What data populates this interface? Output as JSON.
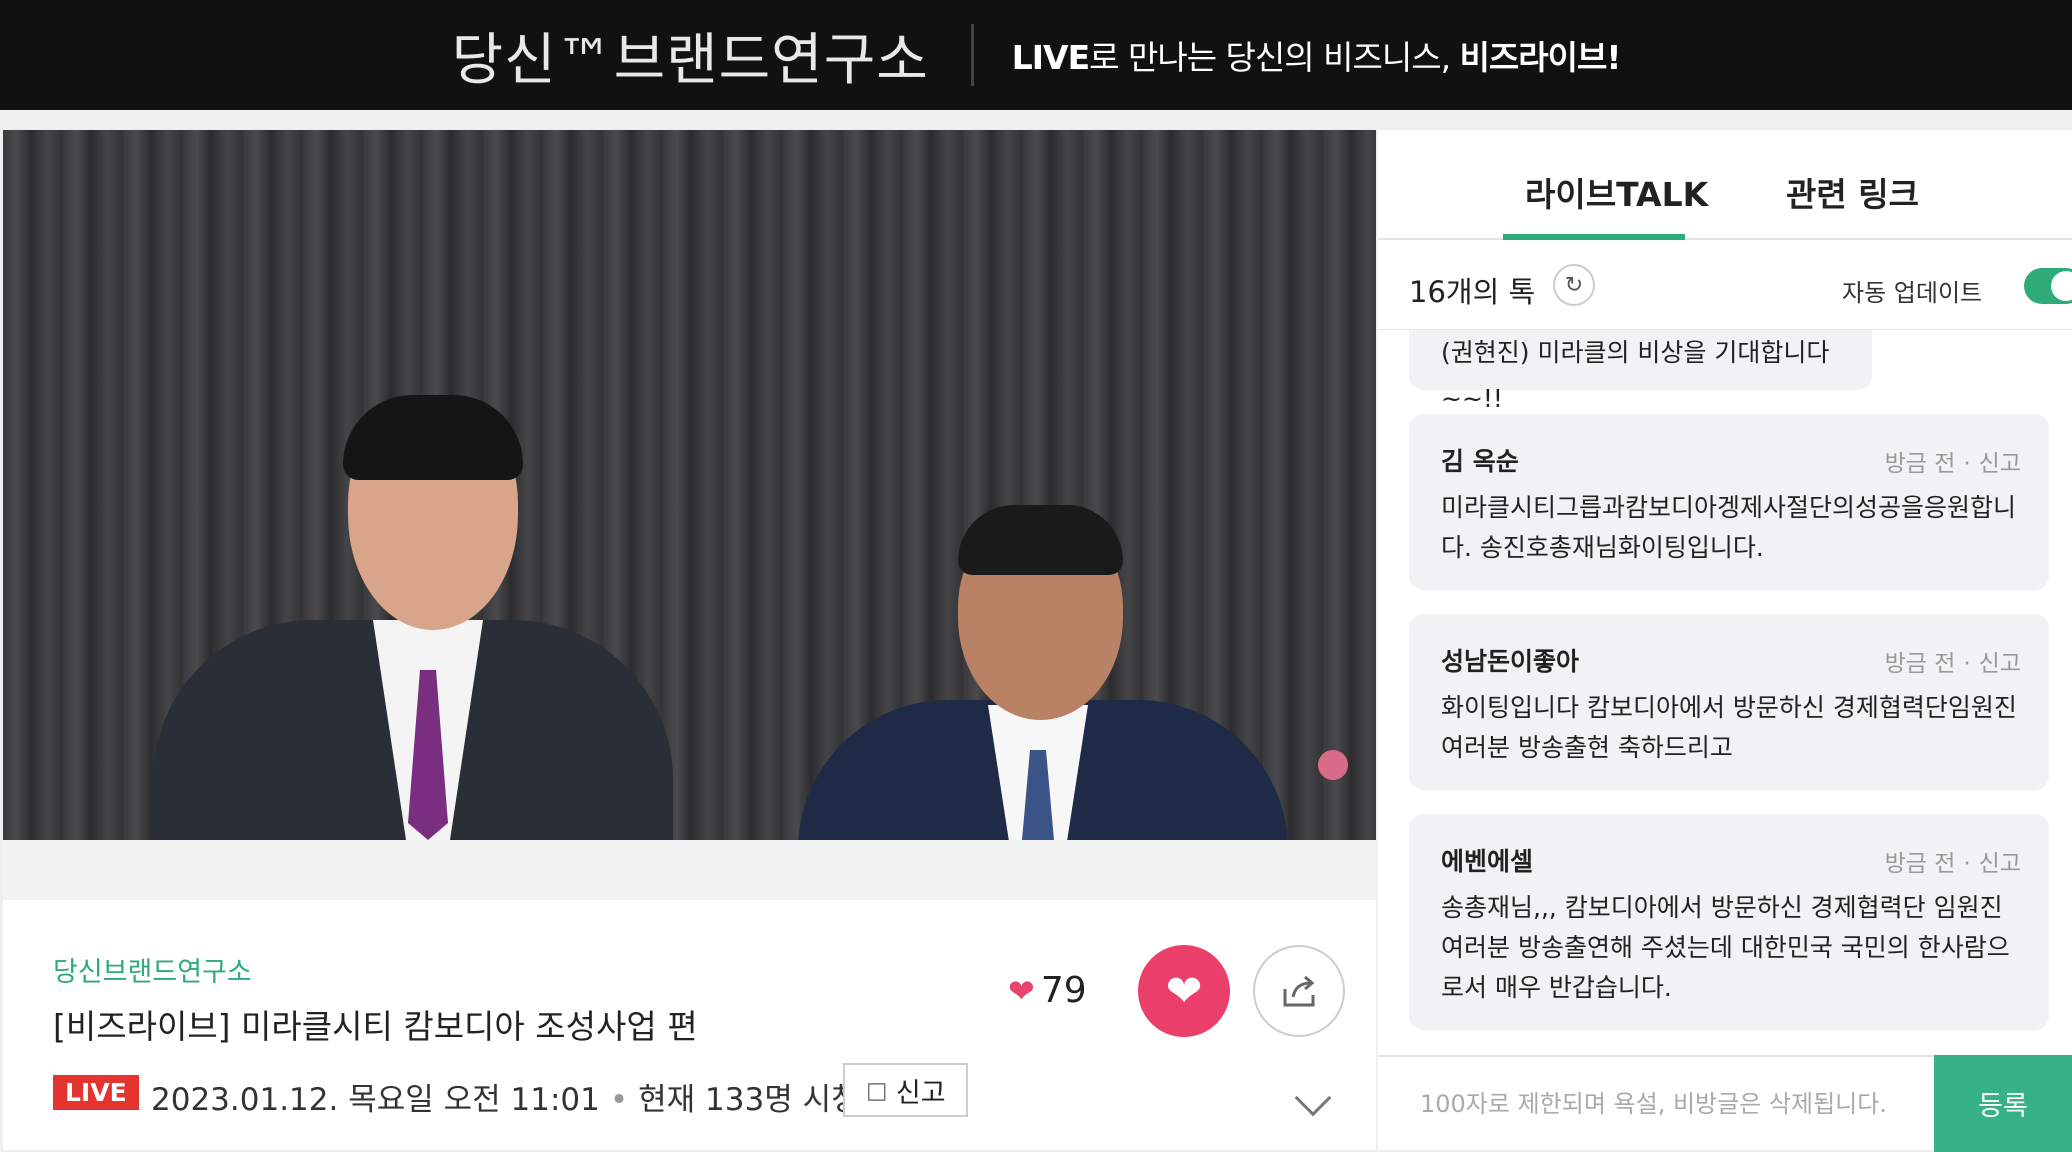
{
  "header": {
    "brand": "당신™브랜드연구소",
    "tagline_live": "LIVE",
    "tagline_mid": "로 만나는 당신의 비즈니스, ",
    "tagline_end": "비즈라이브!"
  },
  "video": {
    "channel": "당신브랜드연구소",
    "title": "[비즈라이브] 미라클시티 캄보디아 조성사업 편",
    "likes": "79",
    "live_badge": "LIVE",
    "datetime": "2023.01.12. 목요일 오전 11:01",
    "viewers": "현재 133명 시청",
    "report_label": "신고"
  },
  "sidebar": {
    "tabs": [
      {
        "label": "라이브TALK",
        "active": true
      },
      {
        "label": "관련 링크",
        "active": false
      }
    ],
    "talk_count": "16개의 톡",
    "auto_update_label": "자동 업데이트",
    "auto_update_on": true,
    "messages": [
      {
        "author": "",
        "time": "",
        "report": "",
        "text": "(권현진) 미라클의 비상을 기대합니다~~!!"
      },
      {
        "author": "김 옥순",
        "time": "방금 전",
        "report": "신고",
        "text": "미라클시티그릅과캄보디아겡제사절단의성공을응원합니다. 송진호총재님화이팅입니다."
      },
      {
        "author": "성남돈이좋아",
        "time": "방금 전",
        "report": "신고",
        "text": "화이팅입니다 캄보디아에서 방문하신 경제협력단임원진 여러분 방송출현 축하드리고"
      },
      {
        "author": "에벤에셀",
        "time": "방금 전",
        "report": "신고",
        "text": "송총재님,,, 캄보디아에서 방문하신 경제협력단 임원진 여러분 방송출연해 주셨는데 대한민국 국민의 한사람으로서 매우 반갑습니다."
      }
    ],
    "input_placeholder": "100자로 제한되며 욕설, 비방글은 삭제됩니다.",
    "submit_label": "등록"
  },
  "icons": {
    "refresh": "refresh-icon",
    "share": "share-icon",
    "heart": "heart-icon",
    "bell": "bell-icon",
    "chevron": "chevron-down-icon"
  },
  "colors": {
    "accent_green": "#2dab78",
    "like_pink": "#ea3f6b",
    "live_red": "#e3342f",
    "header_bg": "#111111"
  }
}
